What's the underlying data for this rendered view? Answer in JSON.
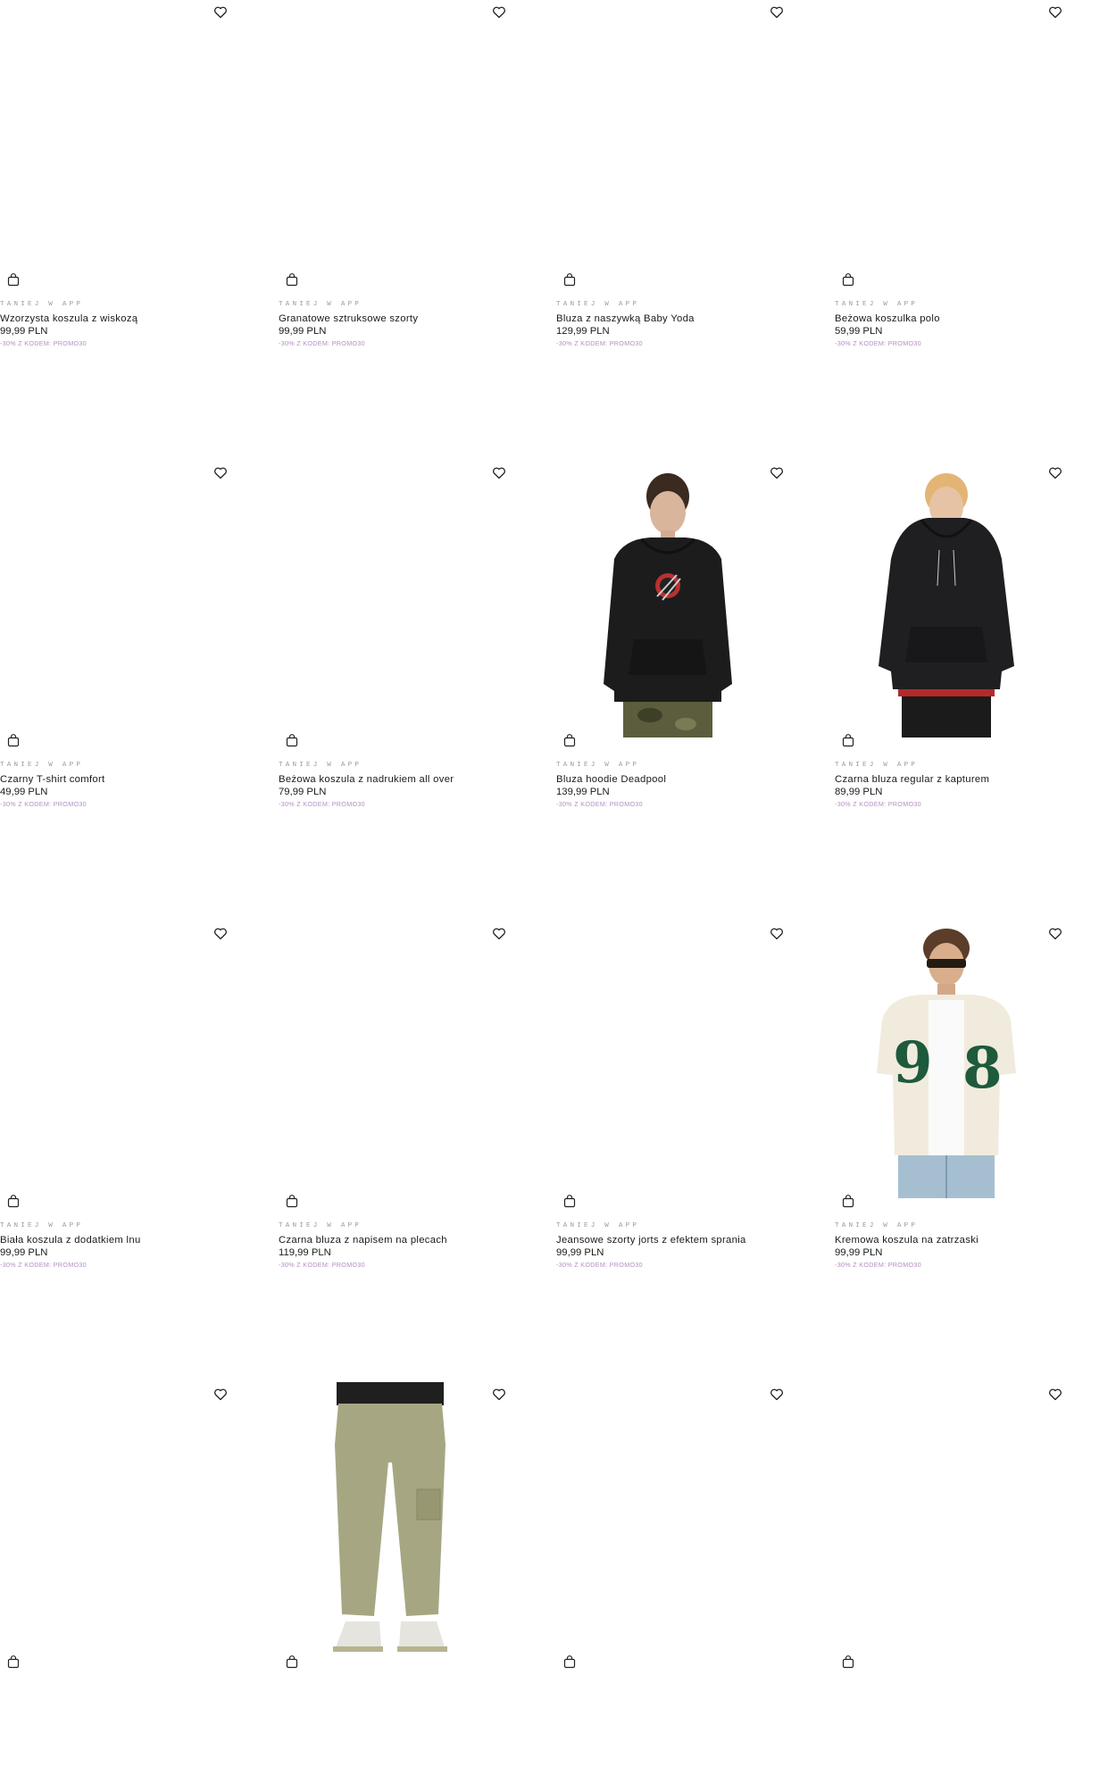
{
  "products": [
    {
      "name": "Wzorzysta koszula z wiskozą",
      "price": "99,99 PLN",
      "tag": "TANIEJ W APP",
      "code": "-30% Z KODEM: PROMO30",
      "image": "none"
    },
    {
      "name": "Granatowe sztruksowe szorty",
      "price": "99,99 PLN",
      "tag": "TANIEJ W APP",
      "code": "-30% Z KODEM: PROMO30",
      "image": "none"
    },
    {
      "name": "Bluza z naszywką Baby Yoda",
      "price": "129,99 PLN",
      "tag": "TANIEJ W APP",
      "code": "-30% Z KODEM: PROMO30",
      "image": "none"
    },
    {
      "name": "Beżowa koszulka polo",
      "price": "59,99 PLN",
      "tag": "TANIEJ W APP",
      "code": "-30% Z KODEM: PROMO30",
      "image": "none"
    },
    {
      "name": "Czarny T-shirt comfort",
      "price": "49,99 PLN",
      "tag": "TANIEJ W APP",
      "code": "-30% Z KODEM: PROMO30",
      "image": "none"
    },
    {
      "name": "Beżowa koszula z nadrukiem all over",
      "price": "79,99 PLN",
      "tag": "TANIEJ W APP",
      "code": "-30% Z KODEM: PROMO30",
      "image": "none"
    },
    {
      "name": "Bluza hoodie Deadpool",
      "price": "139,99 PLN",
      "tag": "TANIEJ W APP",
      "code": "-30% Z KODEM: PROMO30",
      "image": "hoodie-deadpool"
    },
    {
      "name": "Czarna bluza regular z kapturem",
      "price": "89,99 PLN",
      "tag": "TANIEJ W APP",
      "code": "-30% Z KODEM: PROMO30",
      "image": "hoodie-black"
    },
    {
      "name": "Biała koszula z dodatkiem lnu",
      "price": "99,99 PLN",
      "tag": "TANIEJ W APP",
      "code": "-30% Z KODEM: PROMO30",
      "image": "none"
    },
    {
      "name": "Czarna bluza z napisem na plecach",
      "price": "119,99 PLN",
      "tag": "TANIEJ W APP",
      "code": "-30% Z KODEM: PROMO30",
      "image": "none"
    },
    {
      "name": "Jeansowe szorty jorts z efektem sprania",
      "price": "99,99 PLN",
      "tag": "TANIEJ W APP",
      "code": "-30% Z KODEM: PROMO30",
      "image": "none"
    },
    {
      "name": "Kremowa koszula na zatrzaski",
      "price": "99,99 PLN",
      "tag": "TANIEJ W APP",
      "code": "-30% Z KODEM: PROMO30",
      "image": "varsity-shirt"
    },
    {
      "name": "",
      "price": "",
      "tag": "",
      "code": "",
      "image": "none"
    },
    {
      "name": "",
      "price": "",
      "tag": "",
      "code": "",
      "image": "cargo-pants"
    },
    {
      "name": "",
      "price": "",
      "tag": "",
      "code": "",
      "image": "none"
    },
    {
      "name": "",
      "price": "",
      "tag": "",
      "code": "",
      "image": "none"
    }
  ],
  "icons": {
    "wishlist": "heart-icon",
    "cart": "shopping-bag-icon"
  }
}
